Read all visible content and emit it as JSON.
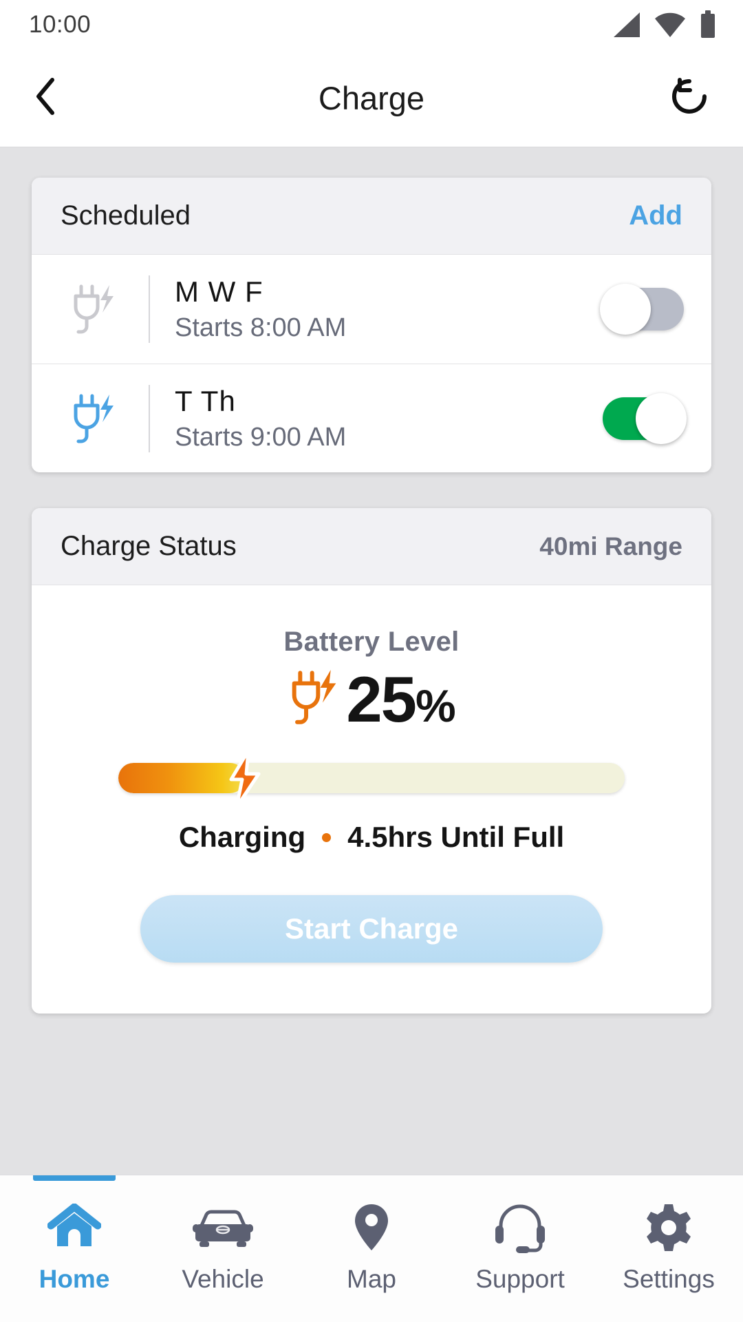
{
  "statusbar": {
    "time": "10:00",
    "icons": [
      "signal-icon",
      "wifi-icon",
      "battery-icon"
    ]
  },
  "appbar": {
    "title": "Charge",
    "back_icon": "chevron-left-icon",
    "refresh_icon": "refresh-icon"
  },
  "scheduled_card": {
    "title": "Scheduled",
    "add_label": "Add",
    "rows": [
      {
        "icon": "plug-charge-icon",
        "icon_color": "#c9c9ce",
        "days": "M W F",
        "time": "Starts 8:00 AM",
        "enabled": false
      },
      {
        "icon": "plug-charge-icon",
        "icon_color": "#4ba3e3",
        "days": "T Th",
        "time": "Starts 9:00 AM",
        "enabled": true
      }
    ]
  },
  "charge_status_card": {
    "title": "Charge Status",
    "range": "40mi Range",
    "battery_label": "Battery Level",
    "battery_percent": "25",
    "percent_unit": "%",
    "plug_icon": "plug-charge-icon",
    "plug_icon_color": "#e8730c",
    "progress_percent": 25,
    "progress_fill_start": "#e8730c",
    "progress_fill_end": "#f3dc4e",
    "progress_track_color": "#f2f2dc",
    "bolt_icon": "lightning-bolt-icon",
    "status_text": "Charging",
    "separator_dot": "orange-dot",
    "eta_text": "4.5hrs Until Full",
    "start_button_label": "Start Charge",
    "start_button_color": "#bfdef4"
  },
  "bottomnav": {
    "items": [
      {
        "label": "Home",
        "icon": "home-icon",
        "active": true
      },
      {
        "label": "Vehicle",
        "icon": "car-icon",
        "active": false
      },
      {
        "label": "Map",
        "icon": "map-pin-icon",
        "active": false
      },
      {
        "label": "Support",
        "icon": "headset-icon",
        "active": false
      },
      {
        "label": "Settings",
        "icon": "gear-icon",
        "active": false
      }
    ],
    "active_color": "#3a9ad9",
    "inactive_color": "#5c6072"
  }
}
